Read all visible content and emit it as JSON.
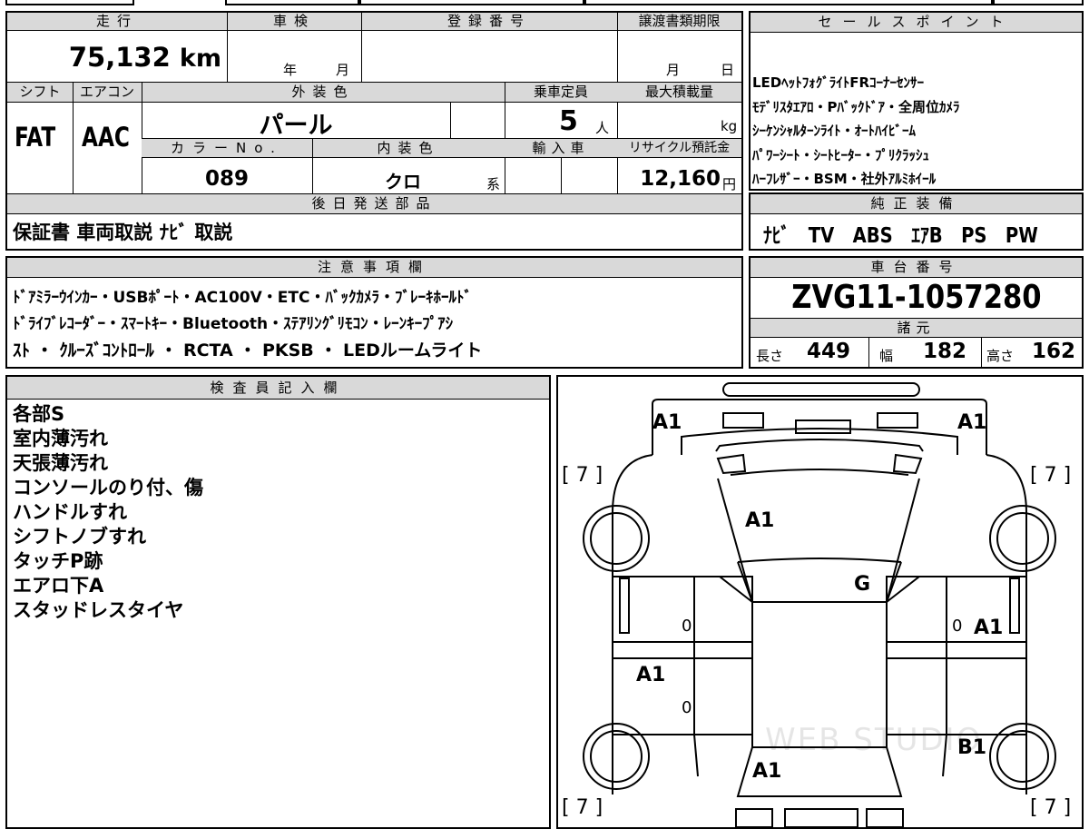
{
  "vehicle": {
    "mileage_label": "走行",
    "mileage": "75,132",
    "mileage_unit": "km",
    "inspection_label": "車検",
    "inspection_year_unit": "年",
    "inspection_month_unit": "月",
    "registration_label": "登録番号",
    "transfer_label": "譲渡書類期限",
    "transfer_month_unit": "月",
    "transfer_day_unit": "日",
    "shift_label": "シフト",
    "shift": "FAT",
    "ac_label": "エアコン",
    "ac": "AAC",
    "exterior_color_label": "外装色",
    "exterior_color": "パール",
    "color_no_label": "カラーNo.",
    "color_no": "089",
    "interior_color_label": "内装色",
    "interior_color": "クロ",
    "interior_color_suffix": "系",
    "capacity_label": "乗車定員",
    "capacity": "5",
    "capacity_unit": "人",
    "max_load_label": "最大積載量",
    "max_load_unit": "kg",
    "import_label": "輸入車",
    "recycle_label": "リサイクル預託金",
    "recycle_fee": "12,160",
    "recycle_unit": "円"
  },
  "sales_points": {
    "title": "セールスポイント",
    "lines": [
      "LEDﾍｯﾄﾌｫｸﾞﾗｲﾄFRｺｰﾅｰｾﾝｻｰ",
      "ﾓﾃﾞﾘｽﾀｴｱﾛ・Pﾊﾞｯｸﾄﾞｱ・全周位ｶﾒﾗ",
      "ｼｰｹﾝｼｬﾙﾀｰﾝﾗｲﾄ・ｵｰﾄﾊｲﾋﾞｰﾑ",
      "ﾊﾟﾜｰｼｰﾄ・ｼｰﾄﾋｰﾀｰ・ﾌﾟﾘｸﾗｯｼｭ",
      "ﾊｰﾌﾚｻﾞｰ・BSM・社外ｱﾙﾐﾎｲｰﾙ"
    ]
  },
  "later_parts": {
    "title": "後日発送部品",
    "value": "保証書 車両取説 ﾅﾋﾞ 取説"
  },
  "factory_equipment": {
    "title": "純正装備",
    "items": [
      "ﾅﾋﾞ",
      "TV",
      "ABS",
      "ｴｱB",
      "PS",
      "PW"
    ]
  },
  "notes": {
    "title": "注意事項欄",
    "lines": [
      "ﾄﾞｱﾐﾗｰｳｲﾝｶｰ・USBﾎﾟｰﾄ・AC100V・ETC・ﾊﾞｯｸｶﾒﾗ・ﾌﾞﾚｰｷﾎｰﾙﾄﾞ",
      "ﾄﾞﾗｲﾌﾞﾚｺｰﾀﾞｰ・ｽﾏｰﾄｷｰ・Bluetooth・ｽﾃｱﾘﾝｸﾞﾘﾓｺﾝ・ﾚｰﾝｷｰﾌﾟｱｼ",
      "ｽﾄ ・ ｸﾙｰｽﾞｺﾝﾄﾛｰﾙ ・ RCTA ・ PKSB ・ LEDルームライト"
    ]
  },
  "chassis": {
    "title": "車台番号",
    "value": "ZVG11-1057280"
  },
  "specs": {
    "title": "諸元",
    "length_label": "長さ",
    "length": "449",
    "width_label": "幅",
    "width": "182",
    "height_label": "高さ",
    "height": "162"
  },
  "inspector": {
    "title": "検査員記入欄",
    "lines": [
      "各部S",
      "室内薄汚れ",
      "天張薄汚れ",
      "コンソールのり付、傷",
      "ハンドルすれ",
      "シフトノブすれ",
      "タッチP跡",
      "エアロ下A",
      "スタッドレスタイヤ"
    ]
  },
  "diagram": {
    "marks": {
      "front_left": "A1",
      "front_right": "A1",
      "hood": "A1",
      "roof": "G",
      "right_front_door": "A1",
      "left_rear_door": "A1",
      "right_rear_door": "B1",
      "rear": "A1",
      "left_front_door_zero": "0",
      "left_rear_door_zero": "0",
      "right_front_door_zero": "0"
    },
    "tire_left_top": "[ 7 ]",
    "tire_right_top": "[ 7 ]",
    "tire_left_bottom": "[ 7 ]",
    "tire_right_bottom": "[ 7 ]",
    "watermark": "WEB STUDIO"
  }
}
